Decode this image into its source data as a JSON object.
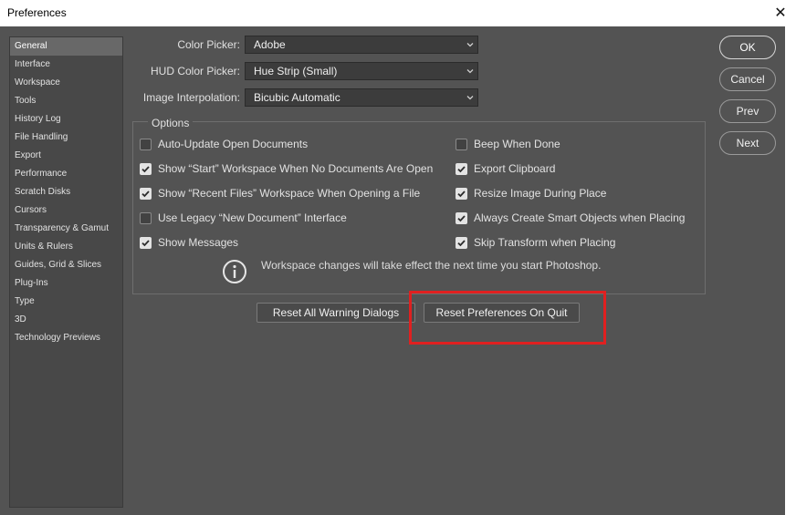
{
  "window": {
    "title": "Preferences",
    "close_glyph": "✕"
  },
  "sidebar": {
    "items": [
      {
        "label": "General",
        "active": true
      },
      {
        "label": "Interface"
      },
      {
        "label": "Workspace"
      },
      {
        "label": "Tools"
      },
      {
        "label": "History Log"
      },
      {
        "label": "File Handling"
      },
      {
        "label": "Export"
      },
      {
        "label": "Performance"
      },
      {
        "label": "Scratch Disks"
      },
      {
        "label": "Cursors"
      },
      {
        "label": "Transparency & Gamut"
      },
      {
        "label": "Units & Rulers"
      },
      {
        "label": "Guides, Grid & Slices"
      },
      {
        "label": "Plug-Ins"
      },
      {
        "label": "Type"
      },
      {
        "label": "3D"
      },
      {
        "label": "Technology Previews"
      }
    ]
  },
  "fields": {
    "color_picker": {
      "label": "Color Picker:",
      "value": "Adobe"
    },
    "hud_color_picker": {
      "label": "HUD Color Picker:",
      "value": "Hue Strip (Small)"
    },
    "image_interpolation": {
      "label": "Image Interpolation:",
      "value": "Bicubic Automatic"
    }
  },
  "options": {
    "legend": "Options",
    "left": [
      {
        "label": "Auto-Update Open Documents",
        "checked": false
      },
      {
        "label": "Show “Start” Workspace When No Documents Are Open",
        "checked": true
      },
      {
        "label": "Show “Recent Files” Workspace When Opening a File",
        "checked": true
      },
      {
        "label": "Use Legacy “New Document” Interface",
        "checked": false
      },
      {
        "label": "Show Messages",
        "checked": true
      }
    ],
    "right": [
      {
        "label": "Beep When Done",
        "checked": false
      },
      {
        "label": "Export Clipboard",
        "checked": true
      },
      {
        "label": "Resize Image During Place",
        "checked": true
      },
      {
        "label": "Always Create Smart Objects when Placing",
        "checked": true
      },
      {
        "label": "Skip Transform when Placing",
        "checked": true
      }
    ],
    "info_text": "Workspace changes will take effect the next time you start Photoshop."
  },
  "buttons": {
    "reset_warnings": "Reset All Warning Dialogs",
    "reset_prefs": "Reset Preferences On Quit",
    "ok": "OK",
    "cancel": "Cancel",
    "prev": "Prev",
    "next": "Next"
  },
  "colors": {
    "dialog_bg": "#535353",
    "sidebar_bg": "#484848",
    "active_item": "#686868",
    "highlight_box": "#e02020"
  }
}
